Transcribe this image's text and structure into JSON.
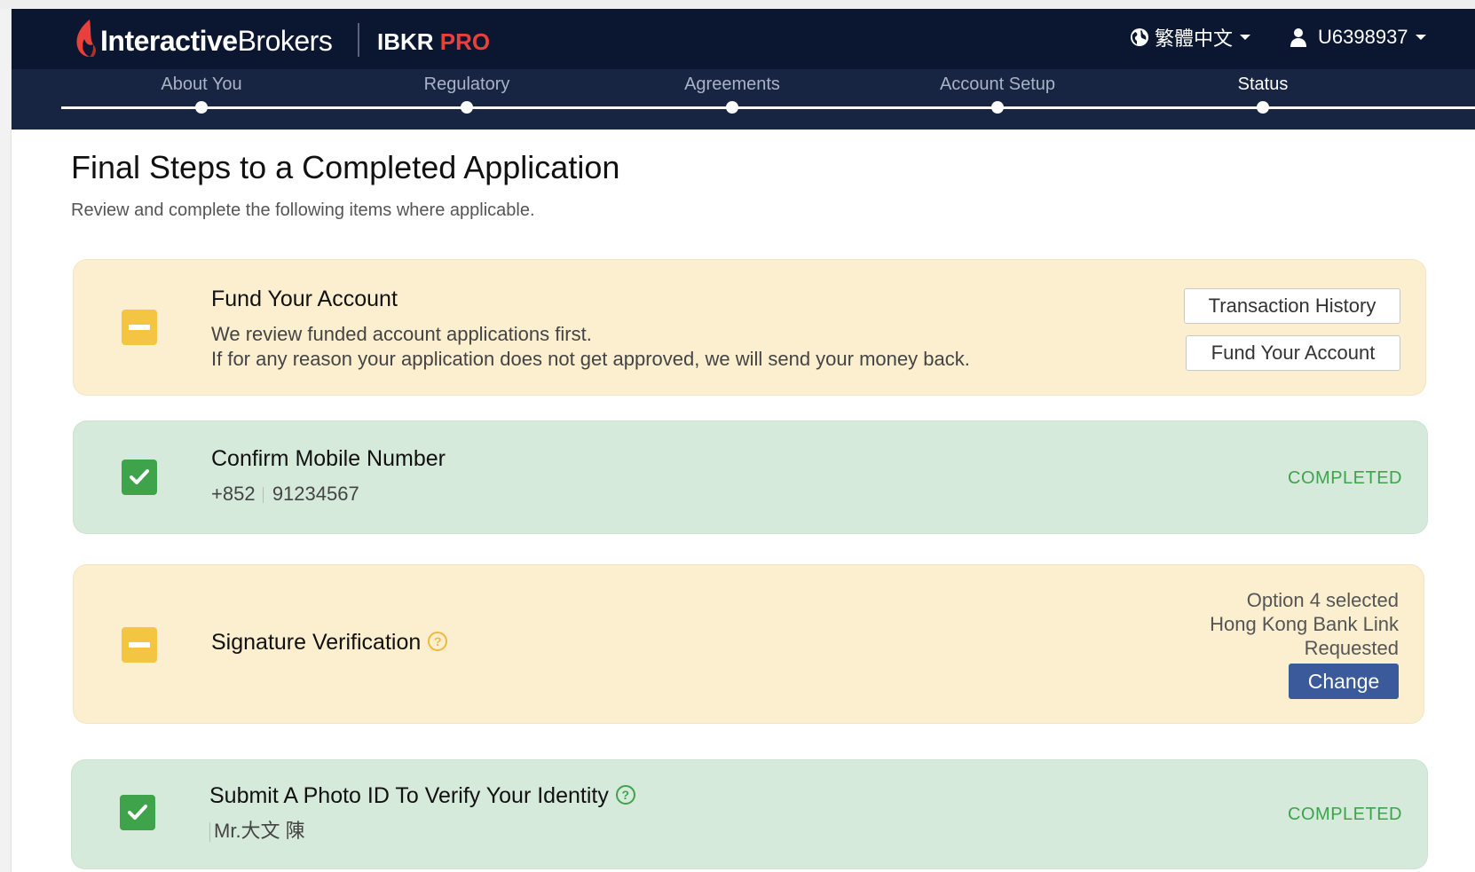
{
  "header": {
    "brand_bold": "Interactive",
    "brand_light": "Brokers",
    "product_prefix": "IBKR",
    "product_suffix": "PRO",
    "language": "繁體中文",
    "account_id": "U6398937"
  },
  "steps": [
    {
      "label": "About You",
      "active": false
    },
    {
      "label": "Regulatory",
      "active": false
    },
    {
      "label": "Agreements",
      "active": false
    },
    {
      "label": "Account Setup",
      "active": false
    },
    {
      "label": "Status",
      "active": true
    }
  ],
  "page": {
    "title": "Final Steps to a Completed Application",
    "subtitle": "Review and complete the following items where applicable."
  },
  "cards": {
    "fund": {
      "title": "Fund Your Account",
      "line1": "We review funded account applications first.",
      "line2": "If for any reason your application does not get approved, we will send your money back.",
      "btn_history": "Transaction History",
      "btn_fund": "Fund Your Account",
      "status": "pending"
    },
    "mobile": {
      "title": "Confirm Mobile Number",
      "country_code": "+852",
      "number": "91234567",
      "status_text": "COMPLETED"
    },
    "signature": {
      "title": "Signature Verification",
      "help": "?",
      "line1": "Option 4 selected",
      "line2": "Hong Kong Bank Link",
      "line3": "Requested",
      "btn_change": "Change",
      "status": "pending"
    },
    "photo": {
      "title": "Submit A Photo ID To Verify Your Identity",
      "help": "?",
      "name": "Mr.大文 陳",
      "status_text": "COMPLETED"
    }
  },
  "colors": {
    "topbar": "#0b1730",
    "stepsbar": "#172543",
    "pending_bg": "#fbefcf",
    "done_bg": "#d6eadb",
    "pending_icon": "#f4c542",
    "done_icon": "#3ea34a",
    "brand_red": "#e8403a",
    "primary_button": "#3a5a9b"
  }
}
